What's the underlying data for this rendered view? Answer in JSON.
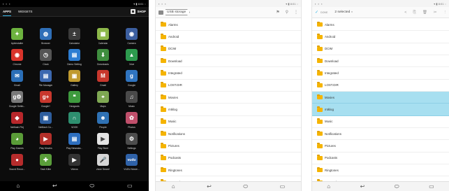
{
  "launcher": {
    "status": {
      "left": [
        "▪",
        "▪",
        "▪"
      ],
      "right": "▾ ▮ 8:01 ◌"
    },
    "tabs": [
      {
        "label": "APPS",
        "active": true
      },
      {
        "label": "WIDGETS",
        "active": false
      }
    ],
    "shop_label": "SHOP",
    "apps": [
      {
        "label": "Apkinstaller",
        "icon": "apkinstaller-icon",
        "glyph": "✦",
        "bg": "#6db33f"
      },
      {
        "label": "Browser",
        "icon": "browser-icon",
        "glyph": "◍",
        "bg": "#2f6fb8"
      },
      {
        "label": "Calculator",
        "icon": "calculator-icon",
        "glyph": "±",
        "bg": "#3b3b3b"
      },
      {
        "label": "Calendar",
        "icon": "calendar-icon",
        "glyph": "▦",
        "bg": "#8db84a"
      },
      {
        "label": "Camera",
        "icon": "camera-icon",
        "glyph": "◉",
        "bg": "#3c5fa0"
      },
      {
        "label": "Chrome",
        "icon": "chrome-icon",
        "glyph": "◉",
        "bg": "#d9342b"
      },
      {
        "label": "Clock",
        "icon": "clock-icon",
        "glyph": "◷",
        "bg": "#555555"
      },
      {
        "label": "Demo Setting",
        "icon": "demo-setting-icon",
        "glyph": "▤",
        "bg": "#2d7dd2"
      },
      {
        "label": "Downloads",
        "icon": "downloads-icon",
        "glyph": "⬇",
        "bg": "#3f8e3f"
      },
      {
        "label": "Drive",
        "icon": "drive-icon",
        "glyph": "▲",
        "bg": "#2d9b4e"
      },
      {
        "label": "Email",
        "icon": "email-icon",
        "glyph": "✉",
        "bg": "#2b6fb7"
      },
      {
        "label": "File Manager",
        "icon": "file-manager-icon",
        "glyph": "▤",
        "bg": "#3c68b0"
      },
      {
        "label": "Gallery",
        "icon": "gallery-icon",
        "glyph": "▣",
        "bg": "#c09a2f"
      },
      {
        "label": "Gmail",
        "icon": "gmail-icon",
        "glyph": "M",
        "bg": "#c8372d"
      },
      {
        "label": "Google",
        "icon": "google-icon",
        "glyph": "g",
        "bg": "#2f74c0"
      },
      {
        "label": "Google Settin...",
        "icon": "google-settings-icon",
        "glyph": "g⚙",
        "bg": "#7a7a7a"
      },
      {
        "label": "Google+",
        "icon": "google-plus-icon",
        "glyph": "g+",
        "bg": "#c8372d"
      },
      {
        "label": "Hangouts",
        "icon": "hangouts-icon",
        "glyph": "❝",
        "bg": "#3e9a3e"
      },
      {
        "label": "Maps",
        "icon": "maps-icon",
        "glyph": "⌖",
        "bg": "#7fa853"
      },
      {
        "label": "Music",
        "icon": "music-icon",
        "glyph": "♫",
        "bg": "#4a4a4a"
      },
      {
        "label": "Netflash Pinj",
        "icon": "netflash-icon",
        "glyph": "◆",
        "bg": "#b8272b"
      },
      {
        "label": "Netflash Co...",
        "icon": "netflash-co-icon",
        "glyph": "▣",
        "bg": "#2e5e9e"
      },
      {
        "label": "NOOK",
        "icon": "nook-icon",
        "glyph": "∩",
        "bg": "#2e8f6f"
      },
      {
        "label": "People",
        "icon": "people-icon",
        "glyph": "☻",
        "bg": "#2f72b5"
      },
      {
        "label": "Photos",
        "icon": "photos-icon",
        "glyph": "✿",
        "bg": "#c04f6b"
      },
      {
        "label": "Play Games",
        "icon": "play-games-icon",
        "glyph": "◕",
        "bg": "#5a9c38"
      },
      {
        "label": "Play Movies",
        "icon": "play-movies-icon",
        "glyph": "▶",
        "bg": "#b4302a"
      },
      {
        "label": "Play Newssta...",
        "icon": "play-newsstand-icon",
        "glyph": "▤",
        "bg": "#2e6fbf"
      },
      {
        "label": "Play Store",
        "icon": "play-store-icon",
        "glyph": "▶",
        "bg": "#e4e4e4"
      },
      {
        "label": "Settings",
        "icon": "settings-icon",
        "glyph": "⚙",
        "bg": "#4d4d4d"
      },
      {
        "label": "Sound Recor...",
        "icon": "sound-recorder-icon",
        "glyph": "●",
        "bg": "#b62c2c"
      },
      {
        "label": "Task Killer",
        "icon": "task-killer-icon",
        "glyph": "✚",
        "bg": "#5a9e3a"
      },
      {
        "label": "Videos",
        "icon": "videos-icon",
        "glyph": "▶",
        "bg": "#333333"
      },
      {
        "label": "Voice Search",
        "icon": "voice-search-icon",
        "glyph": "🎤",
        "bg": "#d6d6d6"
      },
      {
        "label": "VUDU Movie...",
        "icon": "vudu-icon",
        "glyph": "vudu",
        "bg": "#2f62a8"
      }
    ],
    "nav": [
      {
        "icon": "home-outline-icon",
        "glyph": "⌂"
      },
      {
        "icon": "back-icon",
        "glyph": "↩"
      },
      {
        "icon": "home-icon",
        "glyph": "⬭"
      },
      {
        "icon": "recents-icon",
        "glyph": "▭"
      }
    ]
  },
  "browser": {
    "status": {
      "left": [
        "▪",
        "▪",
        "▪"
      ],
      "right": "▾ ▮ 8:01 ◌"
    },
    "breadcrumb": "USB storage",
    "actions": [
      {
        "icon": "select-icon",
        "glyph": "⚑"
      },
      {
        "icon": "search-icon",
        "glyph": "⚲"
      },
      {
        "icon": "overflow-menu-icon",
        "glyph": "⋮"
      }
    ],
    "folders": [
      {
        "name": "Alarms"
      },
      {
        "name": "Android"
      },
      {
        "name": "DCIM"
      },
      {
        "name": "Download"
      },
      {
        "name": "Integrated"
      },
      {
        "name": "LOST.DIR"
      },
      {
        "name": "Movies"
      },
      {
        "name": "mtklog"
      },
      {
        "name": "Music"
      },
      {
        "name": "Notifications"
      },
      {
        "name": "Pictures"
      },
      {
        "name": "Podcasts"
      },
      {
        "name": "Ringtones"
      },
      {
        "name": "Screenshots"
      }
    ],
    "nav": [
      {
        "icon": "home-outline-icon",
        "glyph": "⌂"
      },
      {
        "icon": "back-icon",
        "glyph": "↩"
      },
      {
        "icon": "home-icon",
        "glyph": "⬭"
      },
      {
        "icon": "recents-icon",
        "glyph": "▭"
      }
    ]
  },
  "selection": {
    "status": {
      "left": [
        "▪",
        "▪",
        "▪"
      ],
      "right": "▾ ▮ 8:01 ◌"
    },
    "done_glyph": "✓",
    "done_label": "DONE",
    "count_label": "2 selected",
    "caret": "▾",
    "actions": [
      {
        "icon": "share-icon",
        "glyph": "<"
      },
      {
        "icon": "copy-icon",
        "glyph": "⎘"
      },
      {
        "icon": "delete-icon",
        "glyph": "🗑"
      },
      {
        "icon": "cut-icon",
        "glyph": "✂"
      },
      {
        "icon": "overflow-menu-icon",
        "glyph": "⋮"
      }
    ],
    "folders": [
      {
        "name": "Alarms",
        "selected": false
      },
      {
        "name": "Android",
        "selected": false
      },
      {
        "name": "DCIM",
        "selected": false
      },
      {
        "name": "Download",
        "selected": false
      },
      {
        "name": "Integrated",
        "selected": false
      },
      {
        "name": "LOST.DIR",
        "selected": false
      },
      {
        "name": "Movies",
        "selected": true
      },
      {
        "name": "mtklog",
        "selected": true
      },
      {
        "name": "Music",
        "selected": false
      },
      {
        "name": "Notifications",
        "selected": false
      },
      {
        "name": "Pictures",
        "selected": false
      },
      {
        "name": "Podcasts",
        "selected": false
      },
      {
        "name": "Ringtones",
        "selected": false
      },
      {
        "name": "Screenshots",
        "selected": false
      }
    ],
    "nav": [
      {
        "icon": "home-outline-icon",
        "glyph": "⌂"
      },
      {
        "icon": "back-icon",
        "glyph": "↩"
      },
      {
        "icon": "home-icon",
        "glyph": "⬭"
      },
      {
        "icon": "recents-icon",
        "glyph": "▭"
      }
    ]
  }
}
